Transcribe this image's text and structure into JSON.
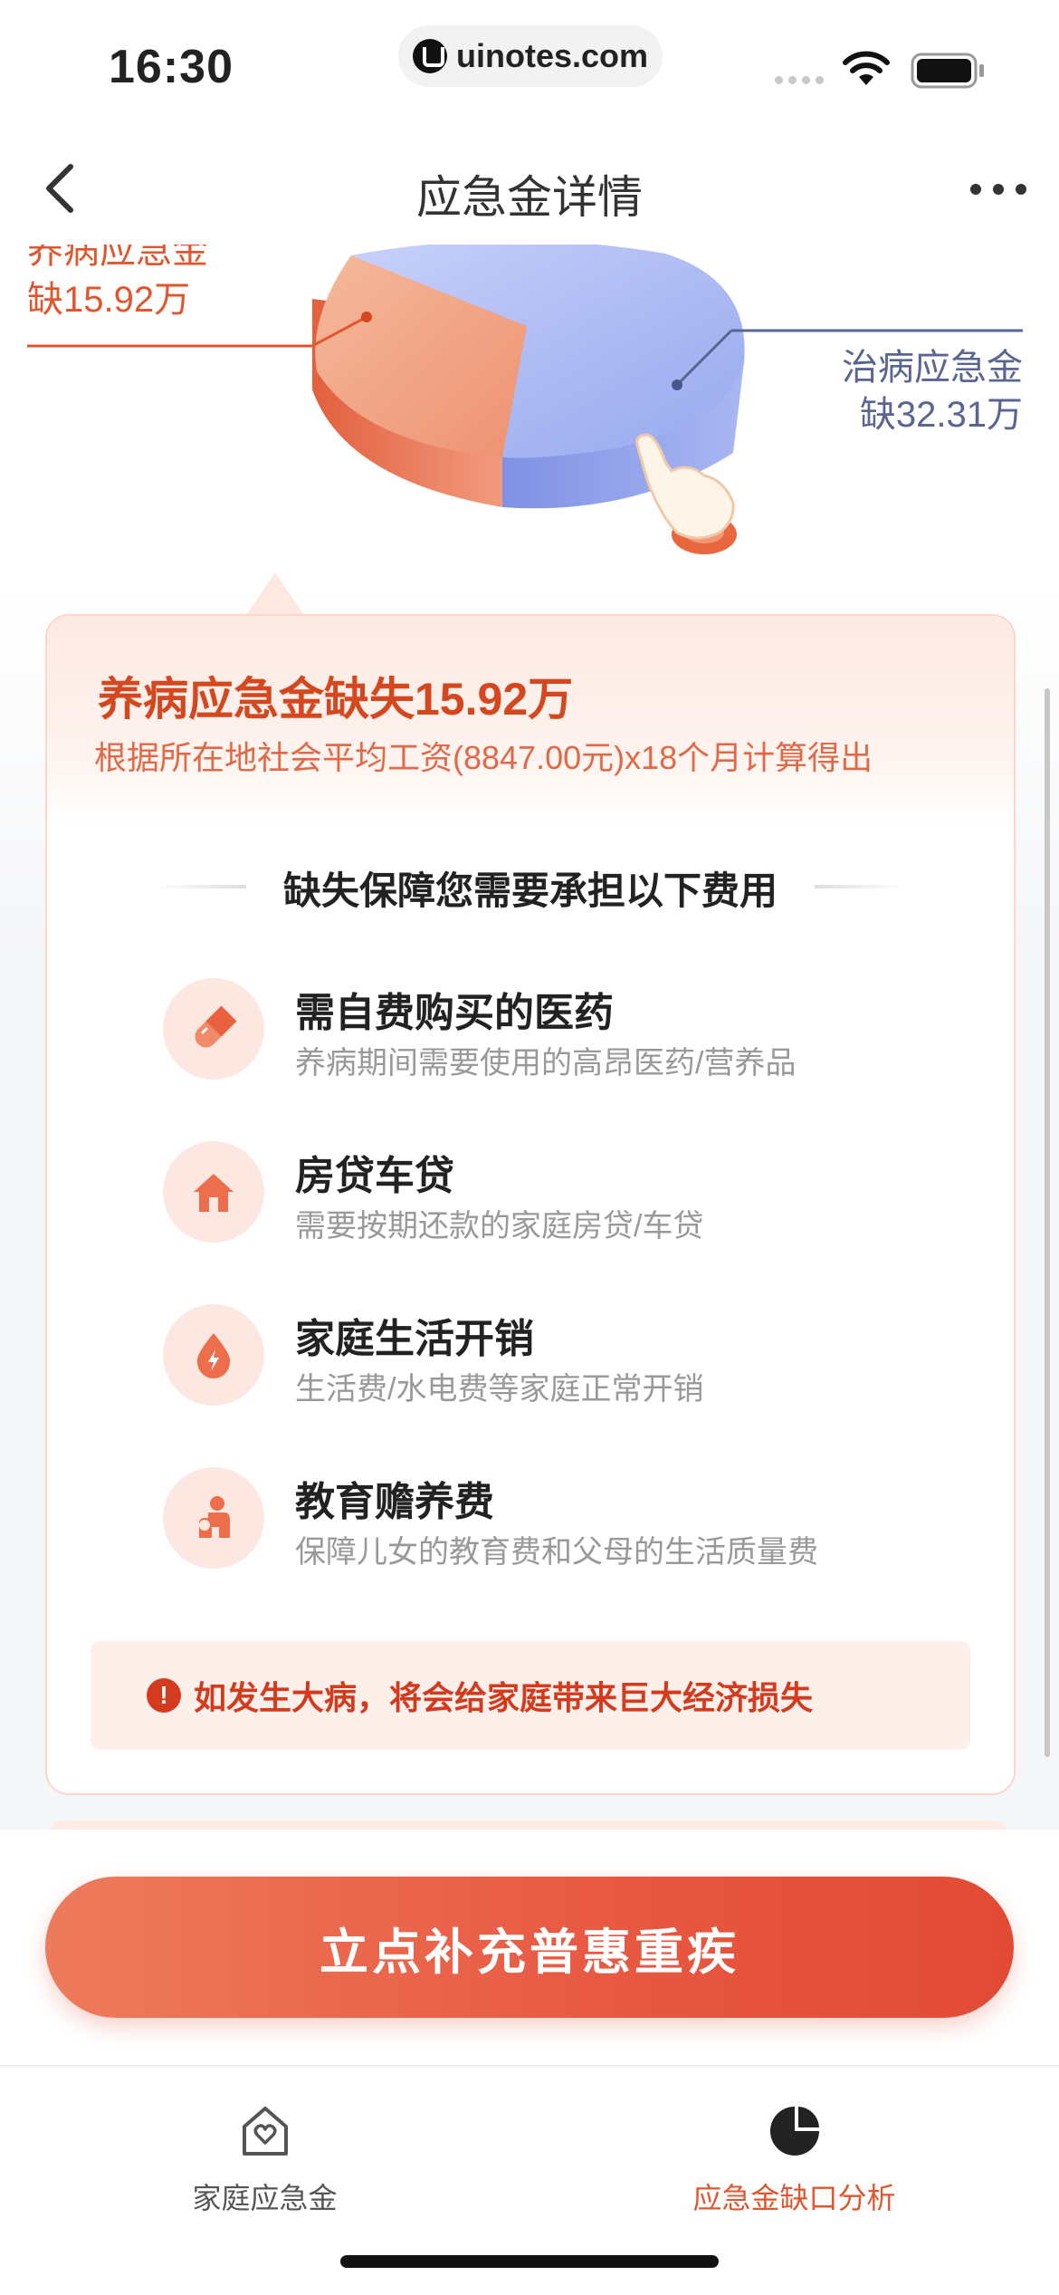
{
  "status_bar": {
    "time": "16:30",
    "url": "uinotes.com"
  },
  "nav": {
    "title": "应急金详情"
  },
  "chart": {
    "left_label": {
      "title": "养病应急金",
      "value": "缺15.92万"
    },
    "right_label": {
      "title": "治病应急金",
      "value": "缺32.31万"
    },
    "colors": {
      "left_slice": "#ee8a68",
      "right_slice": "#9fb0f0"
    }
  },
  "card": {
    "title": "养病应急金缺失15.92万",
    "subtitle": "根据所在地社会平均工资(8847.00元)x18个月计算得出",
    "section_title": "缺失保障您需要承担以下费用",
    "items": [
      {
        "title": "需自费购买的医药",
        "desc": "养病期间需要使用的高昂医药/营养品",
        "icon": "pill-icon"
      },
      {
        "title": "房贷车贷",
        "desc": "需要按期还款的家庭房贷/车贷",
        "icon": "house-icon"
      },
      {
        "title": "家庭生活开销",
        "desc": "生活费/水电费等家庭正常开销",
        "icon": "energy-drop-icon"
      },
      {
        "title": "教育赡养费",
        "desc": "保障儿女的教育费和父母的生活质量费",
        "icon": "family-icon"
      }
    ],
    "warning": "如发生大病，将会给家庭带来巨大经济损失"
  },
  "cta": {
    "label": "立点补充普惠重疾"
  },
  "tabs": [
    {
      "label": "家庭应急金",
      "active": false,
      "color": "#555555"
    },
    {
      "label": "应急金缺口分析",
      "active": true,
      "color": "#e0572f"
    }
  ]
}
